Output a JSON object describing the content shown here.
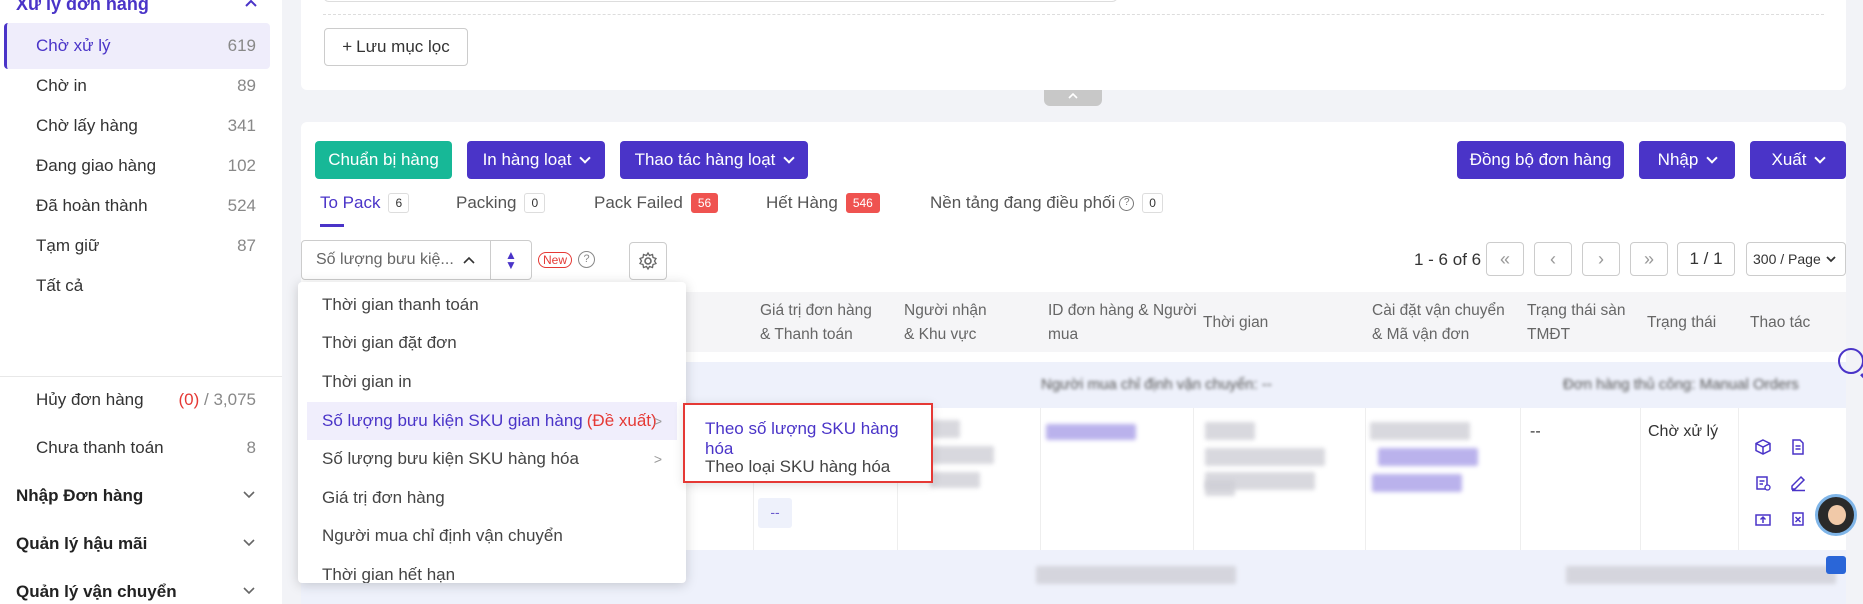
{
  "sidebar": {
    "section_title": "Xử lý đơn hàng",
    "items": [
      {
        "label": "Chờ xử lý",
        "count": "619"
      },
      {
        "label": "Chờ in",
        "count": "89"
      },
      {
        "label": "Chờ lấy hàng",
        "count": "341"
      },
      {
        "label": "Đang giao hàng",
        "count": "102"
      },
      {
        "label": "Đã hoàn thành",
        "count": "524"
      },
      {
        "label": "Tạm giữ",
        "count": "87"
      },
      {
        "label": "Tất cả",
        "count": ""
      }
    ],
    "cancel": {
      "label": "Hủy đơn hàng",
      "pending": "(0)",
      "total": "/ 3,075"
    },
    "unpaid": {
      "label": "Chưa thanh toán",
      "count": "8"
    },
    "groups": [
      "Nhập Đơn hàng",
      "Quản lý hậu mãi",
      "Quản lý vận chuyển"
    ]
  },
  "filter": {
    "save_label": "Lưu mục lọc"
  },
  "toolbar": {
    "prepare": "Chuẩn bị hàng",
    "print_bulk": "In hàng loạt",
    "bulk_actions": "Thao tác hàng loạt",
    "sync": "Đồng bộ đơn hàng",
    "import": "Nhập",
    "export": "Xuất"
  },
  "tabs": [
    {
      "label": "To Pack",
      "count": "6"
    },
    {
      "label": "Packing",
      "count": "0"
    },
    {
      "label": "Pack Failed",
      "count": "56"
    },
    {
      "label": "Hết Hàng",
      "count": "546"
    },
    {
      "label": "Nền tảng đang điều phối",
      "count": "0"
    }
  ],
  "sort": {
    "selected": "Số lượng bưu kiệ...",
    "new_badge": "New"
  },
  "pager": {
    "info": "1 - 6 of 6",
    "page": "1 / 1",
    "page_size": "300 / Page"
  },
  "table": {
    "headers": [
      "Giá trị đơn hàng\n& Thanh toán",
      "Người nhận\n& Khu vực",
      "ID đơn hàng & Người\nmua",
      "Thời gian",
      "Cài đặt vận chuyển\n& Mã vận đơn",
      "Trạng thái sàn\nTMĐT",
      "Trạng thái",
      "Thao tác"
    ],
    "band_text": "Người mua chỉ định vận chuyển: --",
    "band_text_right": "Đơn hàng thủ công: Manual Orders",
    "row_status_platform": "--",
    "row_status": "Chờ xử lý",
    "dash_chip": "--"
  },
  "dropdown": {
    "items": [
      "Thời gian thanh toán",
      "Thời gian đặt đơn",
      "Thời gian in",
      "Số lượng bưu kiện SKU gian hàng",
      "Số lượng bưu kiện SKU hàng hóa",
      "Giá trị đơn hàng",
      "Người mua chỉ định vận chuyển",
      "Thời gian hết hạn"
    ],
    "suggest_tag": "(Đề xuất)"
  },
  "submenu": {
    "items": [
      "Theo số lượng SKU hàng hóa",
      "Theo loại SKU hàng hóa"
    ]
  },
  "colors": {
    "accent": "#4a34c8",
    "green": "#17b897",
    "alert": "#e53935"
  }
}
